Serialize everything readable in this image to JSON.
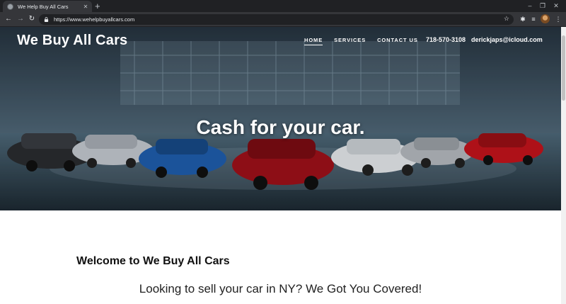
{
  "browser": {
    "tab_title": "We Help Buy All Cars",
    "url": "https://www.wehelpbuyallcars.com"
  },
  "site": {
    "brand": "We Buy All Cars",
    "nav": [
      {
        "label": "HOME",
        "active": true
      },
      {
        "label": "SERVICES",
        "active": false
      },
      {
        "label": "CONTACT US",
        "active": false
      }
    ],
    "phone": "718-570-3108",
    "email": "derickjaps@icloud.com",
    "tagline": "Cash for your car."
  },
  "content": {
    "welcome_heading": "Welcome to We Buy All Cars",
    "subheading": "Looking to sell your car in NY? We Got You Covered!"
  },
  "colors": {
    "tabstrip": "#202124",
    "toolbar": "#35363a",
    "car_colors": [
      "#2b2d30",
      "#c7ccd3",
      "#1f5fb0",
      "#a1101a",
      "#e9ecef",
      "#b8bcc2",
      "#c7141c"
    ]
  },
  "icons": [
    "favicon-icon",
    "close-icon",
    "plus-icon",
    "back-icon",
    "forward-icon",
    "reload-icon",
    "lock-icon",
    "star-icon",
    "puzzle-icon",
    "reading-list-icon",
    "profile-avatar",
    "more-icon"
  ]
}
